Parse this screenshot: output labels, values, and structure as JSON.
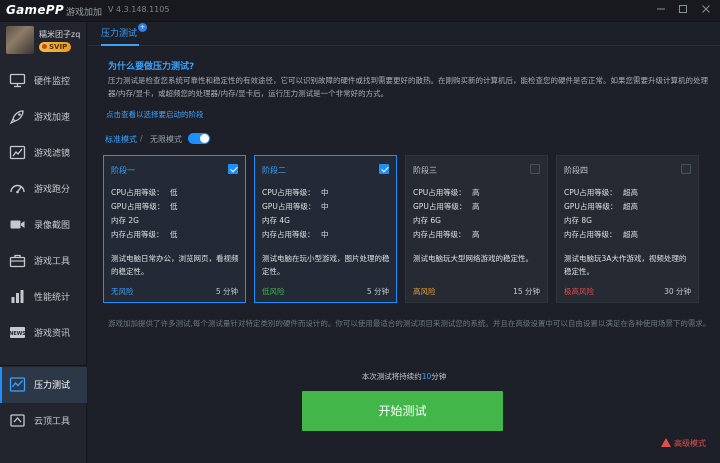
{
  "titlebar": {
    "logo": "GamePP",
    "app_name": "游戏加加",
    "version": "V 4.3.148.1105",
    "icons": [
      "minimize-icon",
      "maximize-icon",
      "close-icon"
    ]
  },
  "profile": {
    "username": "糯米团子zq",
    "badge": "SVIP"
  },
  "nav": [
    {
      "label": "硬件监控",
      "icon": "hardware-monitor-icon"
    },
    {
      "label": "游戏加速",
      "icon": "rocket-icon"
    },
    {
      "label": "游戏滤镜",
      "icon": "filter-icon"
    },
    {
      "label": "游戏跑分",
      "icon": "speedometer-icon"
    },
    {
      "label": "录像截图",
      "icon": "video-camera-icon"
    },
    {
      "label": "游戏工具",
      "icon": "toolbox-icon"
    },
    {
      "label": "性能统计",
      "icon": "chart-icon"
    },
    {
      "label": "游戏资讯",
      "icon": "news-icon"
    },
    {
      "label": "压力测试",
      "icon": "stress-test-icon",
      "active": true
    },
    {
      "label": "云顶工具",
      "icon": "cloud-tool-icon"
    }
  ],
  "main": {
    "tab": "压力测试",
    "tab_badge": "+",
    "question": "为什么要做压力测试?",
    "paragraph": "压力测试是检查您系统可靠性和稳定性的有效途径，它可以识别故障的硬件或找到需要更好的散热。在刚购买新的计算机后，能检查您的硬件是否正常。如果您需要升级计算机的处理器/内存/显卡，或超频您的处理器/内存/显卡后，运行压力测试是一个非常好的方式。",
    "link": "点击查看以选择要启动的阶段",
    "mode_standard": "标准模式",
    "mode_sep": "/",
    "mode_infinite": "无限模式"
  },
  "cards": [
    {
      "title": "阶段一",
      "checked": true,
      "cpu_label": "CPU占用等级：",
      "cpu": "低",
      "gpu_label": "GPU占用等级：",
      "gpu": "低",
      "mem_label": "内存",
      "mem": "2G",
      "memuse_label": "内存占用等级：",
      "memuse": "低",
      "desc": "测试电脑日常办公，浏览网页，看视频的稳定性。",
      "risk": "无风险",
      "risk_color": "#3ba2ff",
      "duration": "5 分钟"
    },
    {
      "title": "阶段二",
      "checked": true,
      "cpu_label": "CPU占用等级：",
      "cpu": "中",
      "gpu_label": "GPU占用等级：",
      "gpu": "中",
      "mem_label": "内存",
      "mem": "4G",
      "memuse_label": "内存占用等级：",
      "memuse": "中",
      "desc": "测试电脑在玩小型游戏，图片处理的稳定性。",
      "risk": "低风险",
      "risk_color": "#3fb950",
      "duration": "5 分钟"
    },
    {
      "title": "阶段三",
      "checked": false,
      "cpu_label": "CPU占用等级：",
      "cpu": "高",
      "gpu_label": "GPU占用等级：",
      "gpu": "高",
      "mem_label": "内存",
      "mem": "6G",
      "memuse_label": "内存占用等级：",
      "memuse": "高",
      "desc": "测试电脑玩大型网络游戏的稳定性。",
      "risk": "高风险",
      "risk_color": "#e8a33c",
      "duration": "15 分钟"
    },
    {
      "title": "阶段四",
      "checked": false,
      "cpu_label": "CPU占用等级：",
      "cpu": "超高",
      "gpu_label": "GPU占用等级：",
      "gpu": "超高",
      "mem_label": "内存",
      "mem": "8G",
      "memuse_label": "内存占用等级：",
      "memuse": "超高",
      "desc": "测试电脑玩3A大作游戏，视频处理的稳定性。",
      "risk": "极高风险",
      "risk_color": "#e0504a",
      "duration": "30 分钟"
    }
  ],
  "footer": {
    "note": "游戏加加提供了许多测试,每个测试量针对特定类别的硬件而设计的。你可以使用最适合的测试项目来测试您的系统。并且在高级设置中可以自由设置以满足在各种使用场景下的需求。",
    "duration_prefix": "本次测试将持续约",
    "duration_value": "10",
    "duration_suffix": "分钟",
    "start_button": "开始测试",
    "advanced": "高级模式"
  }
}
